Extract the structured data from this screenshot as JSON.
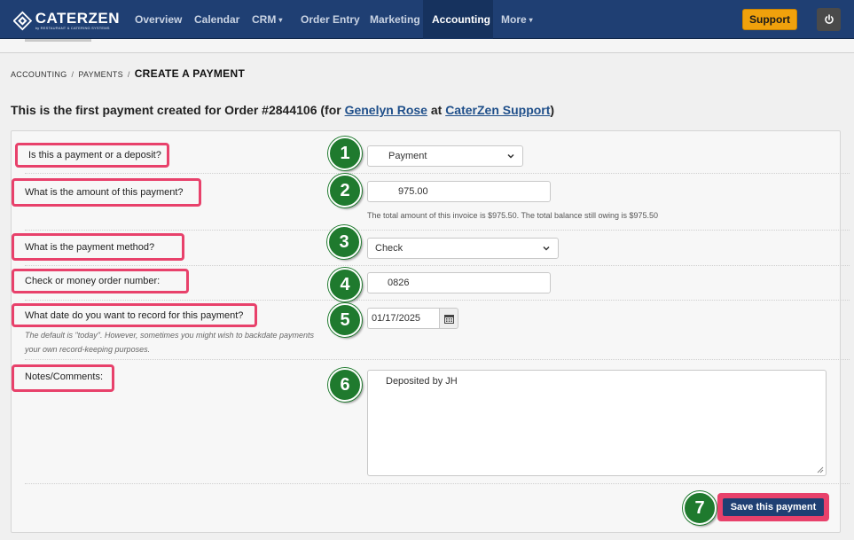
{
  "app": {
    "brand_name": "CATERZEN",
    "brand_subtitle": "by RESTAURANT & CATERING SYSTEMS"
  },
  "nav": {
    "items": [
      {
        "label": "Overview"
      },
      {
        "label": "Calendar"
      },
      {
        "label": "CRM",
        "caret": "▾"
      },
      {
        "label": "Order Entry"
      },
      {
        "label": "Marketing"
      },
      {
        "label": "Accounting"
      },
      {
        "label": "More",
        "caret": "▾"
      }
    ],
    "active": "Accounting",
    "support_label": "Support",
    "power_icon": "power-icon"
  },
  "breadcrumb": {
    "items": [
      "ACCOUNTING",
      "PAYMENTS"
    ],
    "separator": "/",
    "current": "CREATE A PAYMENT"
  },
  "heading": {
    "prefix": "This is the first payment created for Order #2844106 (for ",
    "customer": "Genelyn Rose",
    "middle": " at ",
    "company": "CaterZen Support",
    "suffix": ")"
  },
  "form": {
    "payment_type": {
      "label": "Is this a payment or a deposit?",
      "value": "Payment",
      "step": "1"
    },
    "amount": {
      "label": "What is the amount of this payment?",
      "value": "975.00",
      "help": "The total amount of this invoice is $975.50. The total balance still owing is $975.50",
      "step": "2"
    },
    "method": {
      "label": "What is the payment method?",
      "value": "Check",
      "step": "3"
    },
    "check_number": {
      "label": "Check or money order number:",
      "value": "0826",
      "step": "4"
    },
    "date": {
      "label": "What date do you want to record for this payment?",
      "value": "01/17/2025",
      "help_line1": "The default is \"today\". However, sometimes you might wish to backdate payments",
      "help_line2": "your own record-keeping purposes.",
      "step": "5"
    },
    "notes": {
      "label": "Notes/Comments:",
      "value": "Deposited by JH",
      "step": "6"
    },
    "save": {
      "label": "Save this payment",
      "step": "7"
    }
  },
  "colors": {
    "nav_bg": "#1f3f73",
    "accent": "#f0a10c",
    "highlight": "#e8416b",
    "step_badge": "#1f7a2e"
  }
}
